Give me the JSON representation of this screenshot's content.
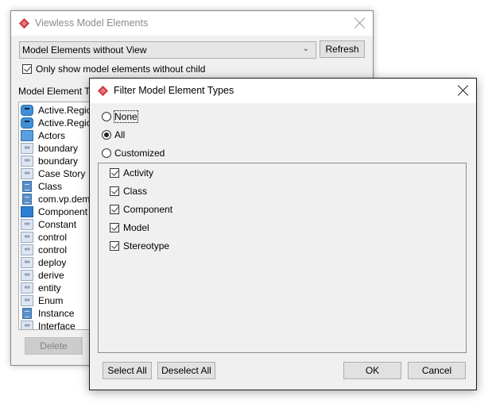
{
  "back_window": {
    "title": "Viewless Model Elements",
    "combo_value": "Model Elements without View",
    "refresh_label": "Refresh",
    "only_without_child_label": "Only show model elements without child",
    "only_without_child_checked": true,
    "tree_header": "Model Element Typ",
    "tree_items": [
      {
        "label": "Active.Region",
        "icon": "region-icon"
      },
      {
        "label": "Active.Region",
        "icon": "region-icon"
      },
      {
        "label": "Actors",
        "icon": "folder-icon"
      },
      {
        "label": "boundary",
        "icon": "stereotype-icon",
        "glyph": "«»"
      },
      {
        "label": "boundary",
        "icon": "stereotype-icon",
        "glyph": "«»"
      },
      {
        "label": "Case Story",
        "icon": "stereotype-icon",
        "glyph": "«»"
      },
      {
        "label": "Class",
        "icon": "class-icon"
      },
      {
        "label": "com.vp.demo",
        "icon": "class-icon"
      },
      {
        "label": "Component",
        "icon": "component-icon"
      },
      {
        "label": "Constant",
        "icon": "stereotype-icon",
        "glyph": "«»"
      },
      {
        "label": "control",
        "icon": "stereotype-icon",
        "glyph": "«»"
      },
      {
        "label": "control",
        "icon": "stereotype-icon",
        "glyph": "«»"
      },
      {
        "label": "deploy",
        "icon": "stereotype-icon",
        "glyph": "«»"
      },
      {
        "label": "derive",
        "icon": "stereotype-icon",
        "glyph": "«»"
      },
      {
        "label": "entity",
        "icon": "stereotype-icon",
        "glyph": "«»"
      },
      {
        "label": "Enum",
        "icon": "stereotype-icon",
        "glyph": "«»"
      },
      {
        "label": "Instance",
        "icon": "class-icon"
      },
      {
        "label": "Interface",
        "icon": "stereotype-icon",
        "glyph": "«»"
      }
    ],
    "delete_label": "Delete"
  },
  "filter_dialog": {
    "title": "Filter Model Element Types",
    "radios": [
      {
        "label": "None",
        "selected": false
      },
      {
        "label": "All",
        "selected": true
      },
      {
        "label": "Customized",
        "selected": false
      }
    ],
    "types": [
      {
        "label": "Activity",
        "checked": true
      },
      {
        "label": "Class",
        "checked": true
      },
      {
        "label": "Component",
        "checked": true
      },
      {
        "label": "Model",
        "checked": true
      },
      {
        "label": "Stereotype",
        "checked": true
      }
    ],
    "select_all_label": "Select All",
    "deselect_all_label": "Deselect All",
    "ok_label": "OK",
    "cancel_label": "Cancel"
  },
  "colors": {
    "logo": "#d0363b",
    "window_bg": "#f0f0f0",
    "button_bg": "#e1e1e1"
  }
}
